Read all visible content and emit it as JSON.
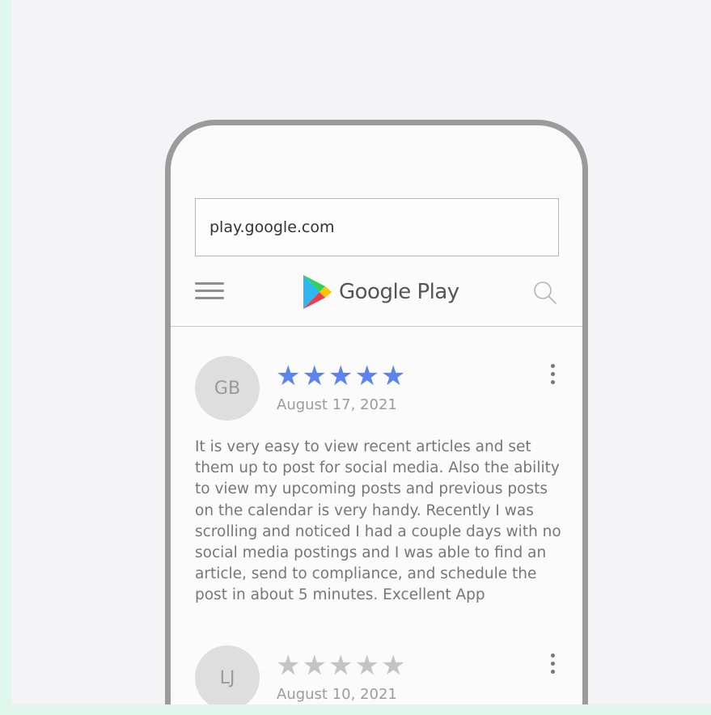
{
  "browser": {
    "url": "play.google.com"
  },
  "header": {
    "logo_text": "Google Play"
  },
  "colors": {
    "star_active": "#5b84f0",
    "star_inactive": "#c4c4c4"
  },
  "reviews": [
    {
      "initials": "GB",
      "rating": 5,
      "date": "August 17, 2021",
      "text": "It is very easy to view recent articles and set them up to post for social media. Also the ability to view my upcoming posts and previous posts on the calendar is very handy. Recently I was scrolling and noticed I had a couple days with no social media postings and I was able to find an article, send to compliance, and schedule the post in about 5 minutes. Excellent App"
    },
    {
      "initials": "LJ",
      "rating": 0,
      "date": "August 10, 2021"
    }
  ]
}
